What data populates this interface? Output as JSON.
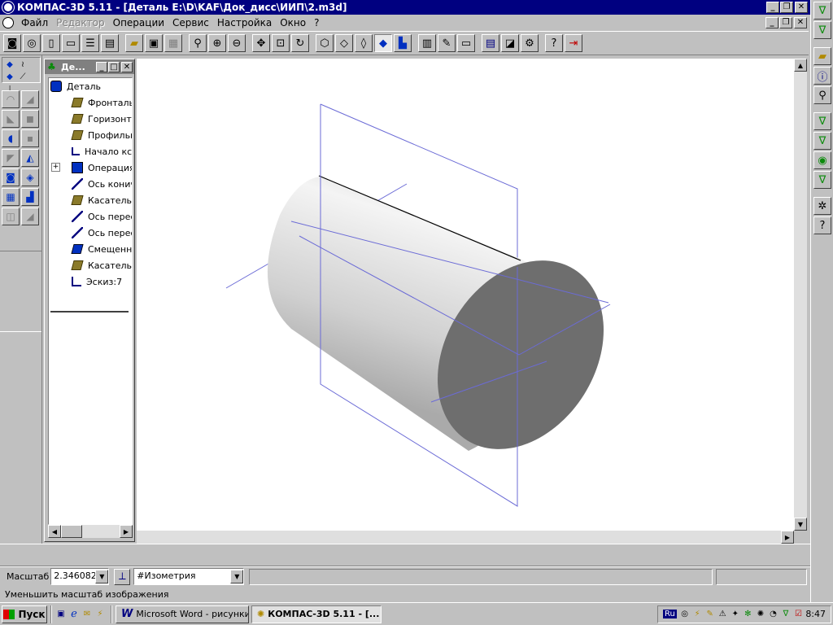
{
  "window": {
    "title": "КОМПАС-3D 5.11 - [Деталь E:\\D\\KAF\\Док_дисс\\ИИП\\2.m3d]"
  },
  "menu": {
    "items": [
      {
        "label": "Файл",
        "enabled": true
      },
      {
        "label": "Редактор",
        "enabled": false
      },
      {
        "label": "Операции",
        "enabled": true
      },
      {
        "label": "Сервис",
        "enabled": true
      },
      {
        "label": "Настройка",
        "enabled": true
      },
      {
        "label": "Окно",
        "enabled": true
      },
      {
        "label": "?",
        "enabled": true
      }
    ]
  },
  "tree": {
    "caption": "Де...",
    "root": "Деталь",
    "nodes": [
      {
        "label": "Фронталь",
        "icon": "plane-icon"
      },
      {
        "label": "Горизонта",
        "icon": "plane-icon"
      },
      {
        "label": "Профильн",
        "icon": "plane-icon"
      },
      {
        "label": "Начало кс",
        "icon": "origin-icon"
      },
      {
        "label": "Операция",
        "icon": "extrusion-icon"
      },
      {
        "label": "Ось конич",
        "icon": "axis-icon"
      },
      {
        "label": "Касательн",
        "icon": "plane-icon"
      },
      {
        "label": "Ось перес",
        "icon": "axis-icon"
      },
      {
        "label": "Ось перес",
        "icon": "axis-icon"
      },
      {
        "label": "Смещенн",
        "icon": "offset-plane-icon"
      },
      {
        "label": "Касательн",
        "icon": "plane-icon"
      },
      {
        "label": "Эскиз:7",
        "icon": "sketch-icon"
      }
    ]
  },
  "propbar": {
    "scale_label": "Масштаб",
    "scale_value": "2.346082",
    "view_value": "#Изометрия"
  },
  "status": {
    "text": "Уменьшить масштаб изображения"
  },
  "taskbar": {
    "start": "Пуск",
    "tasks": [
      {
        "label": "Microsoft Word - рисунки ...",
        "active": false
      },
      {
        "label": "КОМПАС-3D 5.11 - [...",
        "active": true
      }
    ],
    "lang": "Ru",
    "clock": "8:47"
  },
  "colors": {
    "titlebar": "#000080",
    "face": "#c0c0c0",
    "plane_lines": "#6b6bd6",
    "cylinder_end": "#6e6e6e"
  }
}
